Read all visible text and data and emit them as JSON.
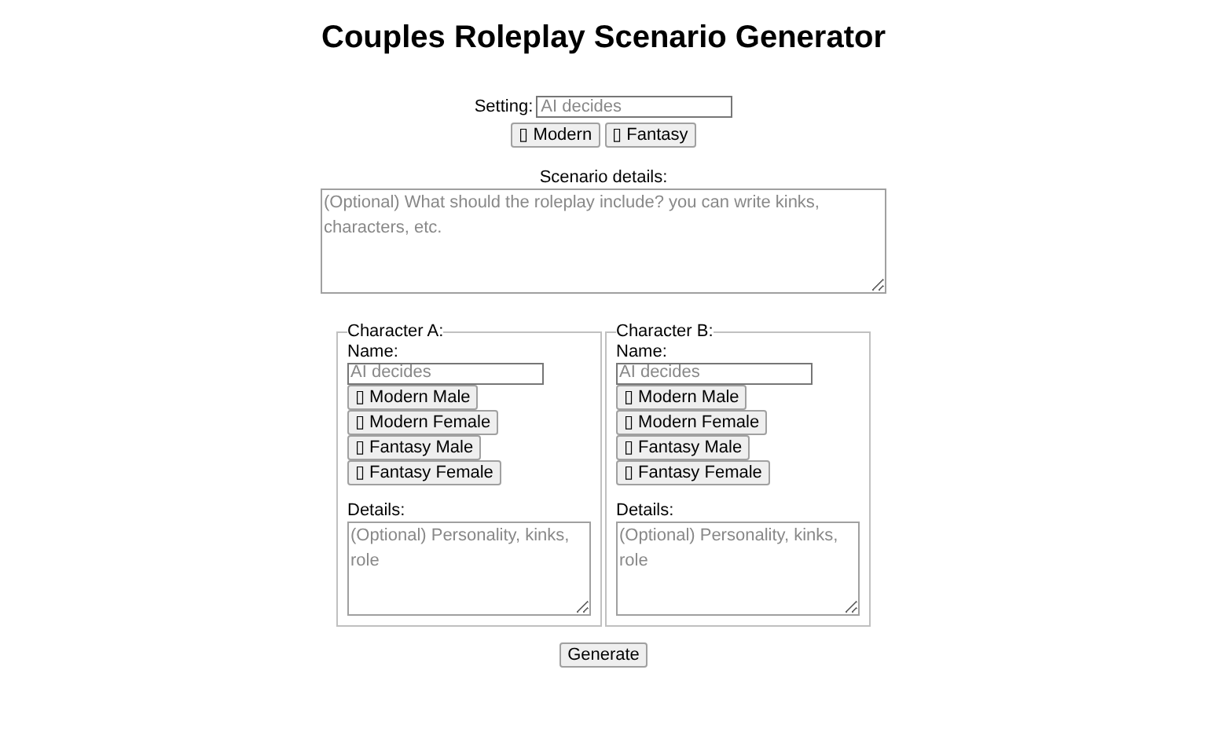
{
  "title": "Couples Roleplay Scenario Generator",
  "setting": {
    "label": "Setting:",
    "placeholder": "AI decides",
    "buttons": [
      "▯ Modern",
      "▯ Fantasy"
    ]
  },
  "scenario": {
    "label": "Scenario details:",
    "placeholder": "(Optional) What should the roleplay include? you can write kinks, characters, etc."
  },
  "characters": [
    {
      "legend": "Character A:",
      "name_label": "Name:",
      "name_placeholder": "AI decides",
      "buttons": [
        "▯ Modern Male",
        "▯ Modern Female",
        "▯ Fantasy Male",
        "▯ Fantasy Female"
      ],
      "details_label": "Details:",
      "details_placeholder": "(Optional) Personality, kinks, role"
    },
    {
      "legend": "Character B:",
      "name_label": "Name:",
      "name_placeholder": "AI decides",
      "buttons": [
        "▯ Modern Male",
        "▯ Modern Female",
        "▯ Fantasy Male",
        "▯ Fantasy Female"
      ],
      "details_label": "Details:",
      "details_placeholder": "(Optional) Personality, kinks, role"
    }
  ],
  "generate_button": "Generate"
}
